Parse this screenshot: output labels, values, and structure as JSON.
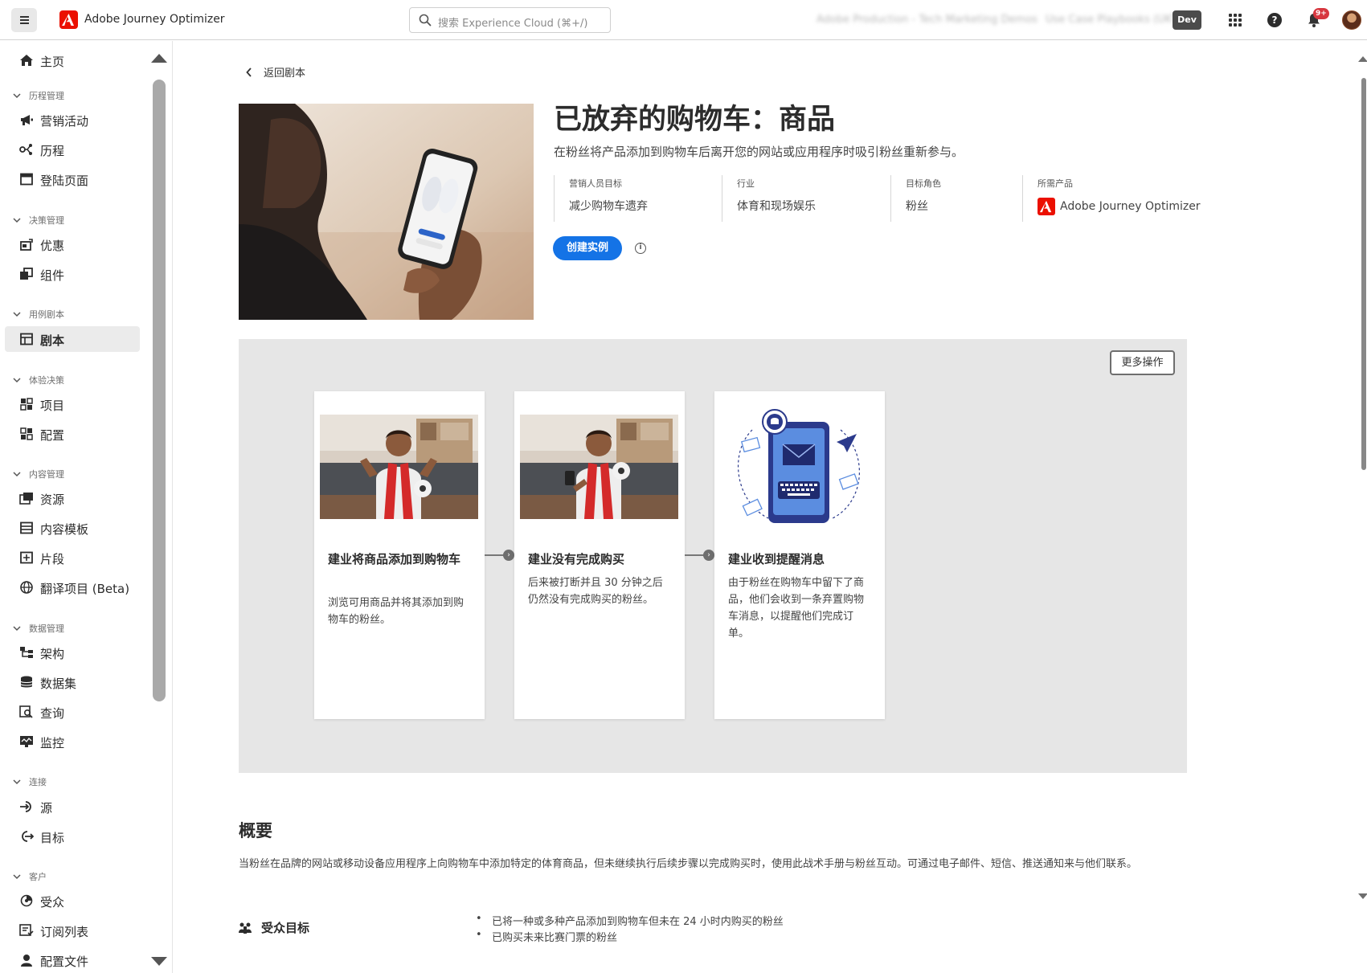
{
  "app": {
    "name": "Adobe Journey Optimizer",
    "search_placeholder": "搜索 Experience Cloud (⌘+/)",
    "org_name": "Adobe Production - Tech Marketing Demos",
    "sandbox_name": "Use Case Playbooks (UKT)",
    "env_badge": "Dev",
    "notification_count": "9+"
  },
  "sidebar": {
    "home": "主页",
    "sections": {
      "journey_mgmt": "历程管理",
      "decision_mgmt": "决策管理",
      "playbooks": "用例剧本",
      "exp_decisioning": "体验决策",
      "content_mgmt": "内容管理",
      "data_mgmt": "数据管理",
      "connections": "连接",
      "customer": "客户"
    },
    "items": {
      "campaigns": "营销活动",
      "journeys": "历程",
      "landing_pages": "登陆页面",
      "offers": "优惠",
      "components": "组件",
      "playbooks": "剧本",
      "items": "项目",
      "config": "配置",
      "assets": "资源",
      "content_templates": "内容模板",
      "fragments": "片段",
      "translation": "翻译项目 (Beta)",
      "schemas": "架构",
      "datasets": "数据集",
      "queries": "查询",
      "monitoring": "监控",
      "sources": "源",
      "destinations": "目标",
      "audiences": "受众",
      "subscription_lists": "订阅列表",
      "profiles": "配置文件"
    }
  },
  "main": {
    "back_label": "返回剧本",
    "title": "已放弃的购物车：商品",
    "description": "在粉丝将产品添加到购物车后离开您的网站或应用程序时吸引粉丝重新参与。",
    "meta": [
      {
        "key": "营销人员目标",
        "value": "减少购物车遗弃"
      },
      {
        "key": "行业",
        "value": "体育和现场娱乐"
      },
      {
        "key": "目标角色",
        "value": "粉丝"
      },
      {
        "key": "所需产品",
        "value": "Adobe Journey Optimizer"
      }
    ],
    "create_button": "创建实例",
    "more_actions": "更多操作",
    "cards": [
      {
        "title": "建业将商品添加到购物车",
        "text": "浏览可用商品并将其添加到购物车的粉丝。"
      },
      {
        "title": "建业没有完成购买",
        "text": "后来被打断并且 30 分钟之后仍然没有完成购买的粉丝。"
      },
      {
        "title": "建业收到提醒消息",
        "text": "由于粉丝在购物车中留下了商品，他们会收到一条弃置购物车消息，以提醒他们完成订单。"
      }
    ],
    "summary_title": "概要",
    "summary_text": "当粉丝在品牌的网站或移动设备应用程序上向购物车中添加特定的体育商品，但未继续执行后续步骤以完成购买时，使用此战术手册与粉丝互动。可通过电子邮件、短信、推送通知来与他们联系。",
    "audience_label": "受众目标",
    "audience_bullets": [
      "已将一种或多种产品添加到购物车但未在 24 小时内购买的粉丝",
      "已购买未来比赛门票的粉丝"
    ]
  },
  "colors": {
    "brand": "#eb1000",
    "accent": "#1473e6",
    "flow_background": "#e6e6e6"
  }
}
